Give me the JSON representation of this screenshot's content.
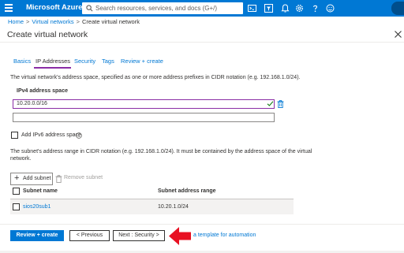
{
  "topbar": {
    "brand": "Microsoft Azure",
    "search_placeholder": "Search resources, services, and docs (G+/)",
    "icons": [
      "menu-icon",
      "search-icon",
      "cloud-shell-icon",
      "directory-filter-icon",
      "bell-icon",
      "gear-icon",
      "help-icon",
      "feedback-icon",
      "avatar"
    ]
  },
  "breadcrumb": {
    "items": [
      "Home",
      "Virtual networks",
      "Create virtual network"
    ],
    "separator": ">"
  },
  "page": {
    "title": "Create virtual network"
  },
  "tabs": [
    {
      "label": "Basics",
      "active": false
    },
    {
      "label": "IP Addresses",
      "active": true
    },
    {
      "label": "Security",
      "active": false
    },
    {
      "label": "Tags",
      "active": false
    },
    {
      "label": "Review + create",
      "active": false
    }
  ],
  "address_space": {
    "description": "The virtual network's address space, specified as one or more address prefixes in CIDR notation (e.g. 192.168.1.0/24).",
    "label": "IPv4 address space",
    "values": [
      "10.20.0.0/16",
      ""
    ]
  },
  "ipv6": {
    "label": "Add IPv6 address space",
    "checked": false
  },
  "subnet_info": {
    "line1": "The subnet's address range in CIDR notation (e.g. 192.168.1.0/24). It must be contained by the address space of the virtual",
    "line2": "network."
  },
  "subnet_actions": {
    "add_label": "Add subnet",
    "remove_label": "Remove subnet"
  },
  "subnet_table": {
    "columns": [
      "Subnet name",
      "Subnet address range"
    ],
    "rows": [
      {
        "name": "sios20sub1",
        "range": "10.20.1.0/24"
      }
    ]
  },
  "footer": {
    "review_label": "Review + create",
    "previous_label": "< Previous",
    "next_label": "Next : Security >",
    "automation_link": "a template for automation"
  },
  "colors": {
    "azure_blue": "#0078d4",
    "tab_accent": "#8a2da5",
    "arrow_red": "#e81123"
  }
}
